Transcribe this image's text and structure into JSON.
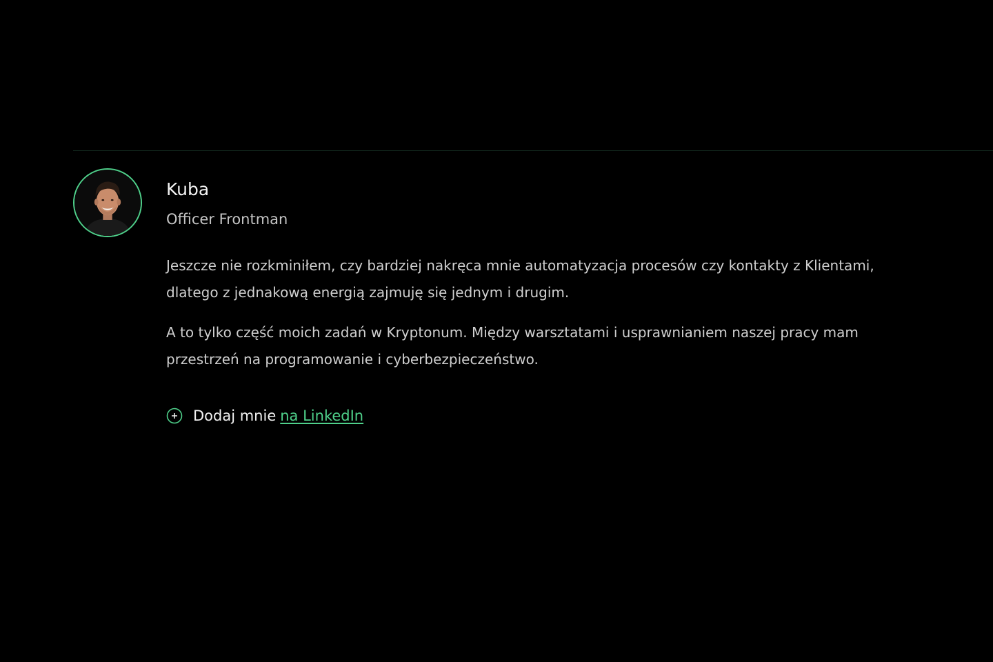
{
  "profile": {
    "name": "Kuba",
    "role": "Officer Frontman",
    "avatar_icon": "person-portrait",
    "bio": [
      "Jeszcze nie rozkminiłem, czy bardziej nakręca mnie automatyzacja procesów czy kontakty z Klientami, dlatego z jednakową energią zajmuję się jednym i drugim.",
      "A to tylko część moich zadań w Kryptonum. Między warsztatami i usprawnianiem naszej pracy mam przestrzeń na programowanie i cyberbezpieczeństwo."
    ]
  },
  "cta": {
    "prefix": "Dodaj mnie",
    "link_label": "na LinkedIn",
    "icon": "plus-circle-icon"
  },
  "colors": {
    "background": "#000000",
    "accent": "#4fd18b",
    "divider": "#13291f",
    "text_primary": "#f2f2f2",
    "text_secondary": "#cfcfcf"
  }
}
